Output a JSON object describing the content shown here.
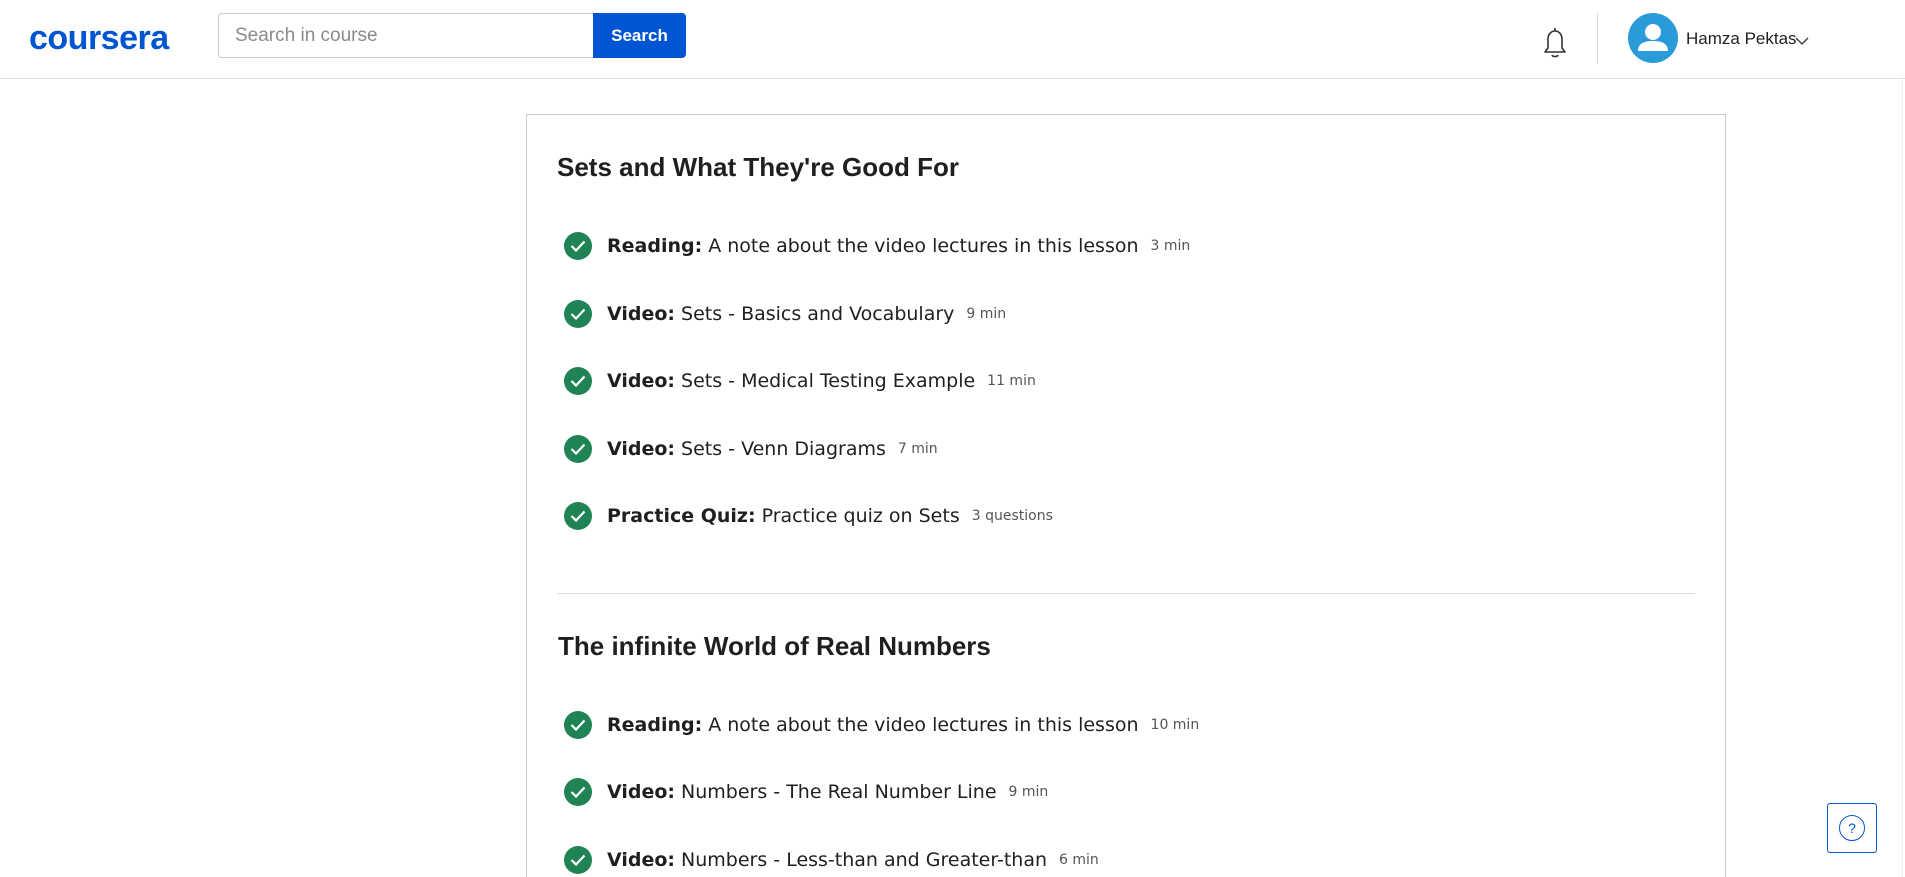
{
  "header": {
    "logo_text": "coursera",
    "search": {
      "placeholder": "Search in course",
      "value": "",
      "button_label": "Search"
    },
    "user": {
      "name": "Hamza Pektas"
    }
  },
  "sections": [
    {
      "title": "Sets and What They're Good For",
      "items": [
        {
          "type": "Reading:",
          "title": "A note about the video lectures in this lesson",
          "duration": "3 min",
          "completed": true
        },
        {
          "type": "Video:",
          "title": "Sets - Basics and Vocabulary",
          "duration": "9 min",
          "completed": true
        },
        {
          "type": "Video:",
          "title": "Sets - Medical Testing Example",
          "duration": "11 min",
          "completed": true
        },
        {
          "type": "Video:",
          "title": "Sets - Venn Diagrams",
          "duration": "7 min",
          "completed": true
        },
        {
          "type": "Practice Quiz:",
          "title": "Practice quiz on Sets",
          "duration": "3 questions",
          "completed": true
        }
      ]
    },
    {
      "title": "The infinite World of Real Numbers",
      "items": [
        {
          "type": "Reading:",
          "title": "A note about the video lectures in this lesson",
          "duration": "10 min",
          "completed": true
        },
        {
          "type": "Video:",
          "title": "Numbers - The Real Number Line",
          "duration": "9 min",
          "completed": true
        },
        {
          "type": "Video:",
          "title": "Numbers - Less-than and Greater-than",
          "duration": "6 min",
          "completed": true
        }
      ]
    }
  ],
  "help": {
    "icon": "help-icon",
    "label": "?"
  },
  "colors": {
    "brand": "#0056d2",
    "completed": "#1f8354",
    "avatar": "#2a9bd8"
  }
}
